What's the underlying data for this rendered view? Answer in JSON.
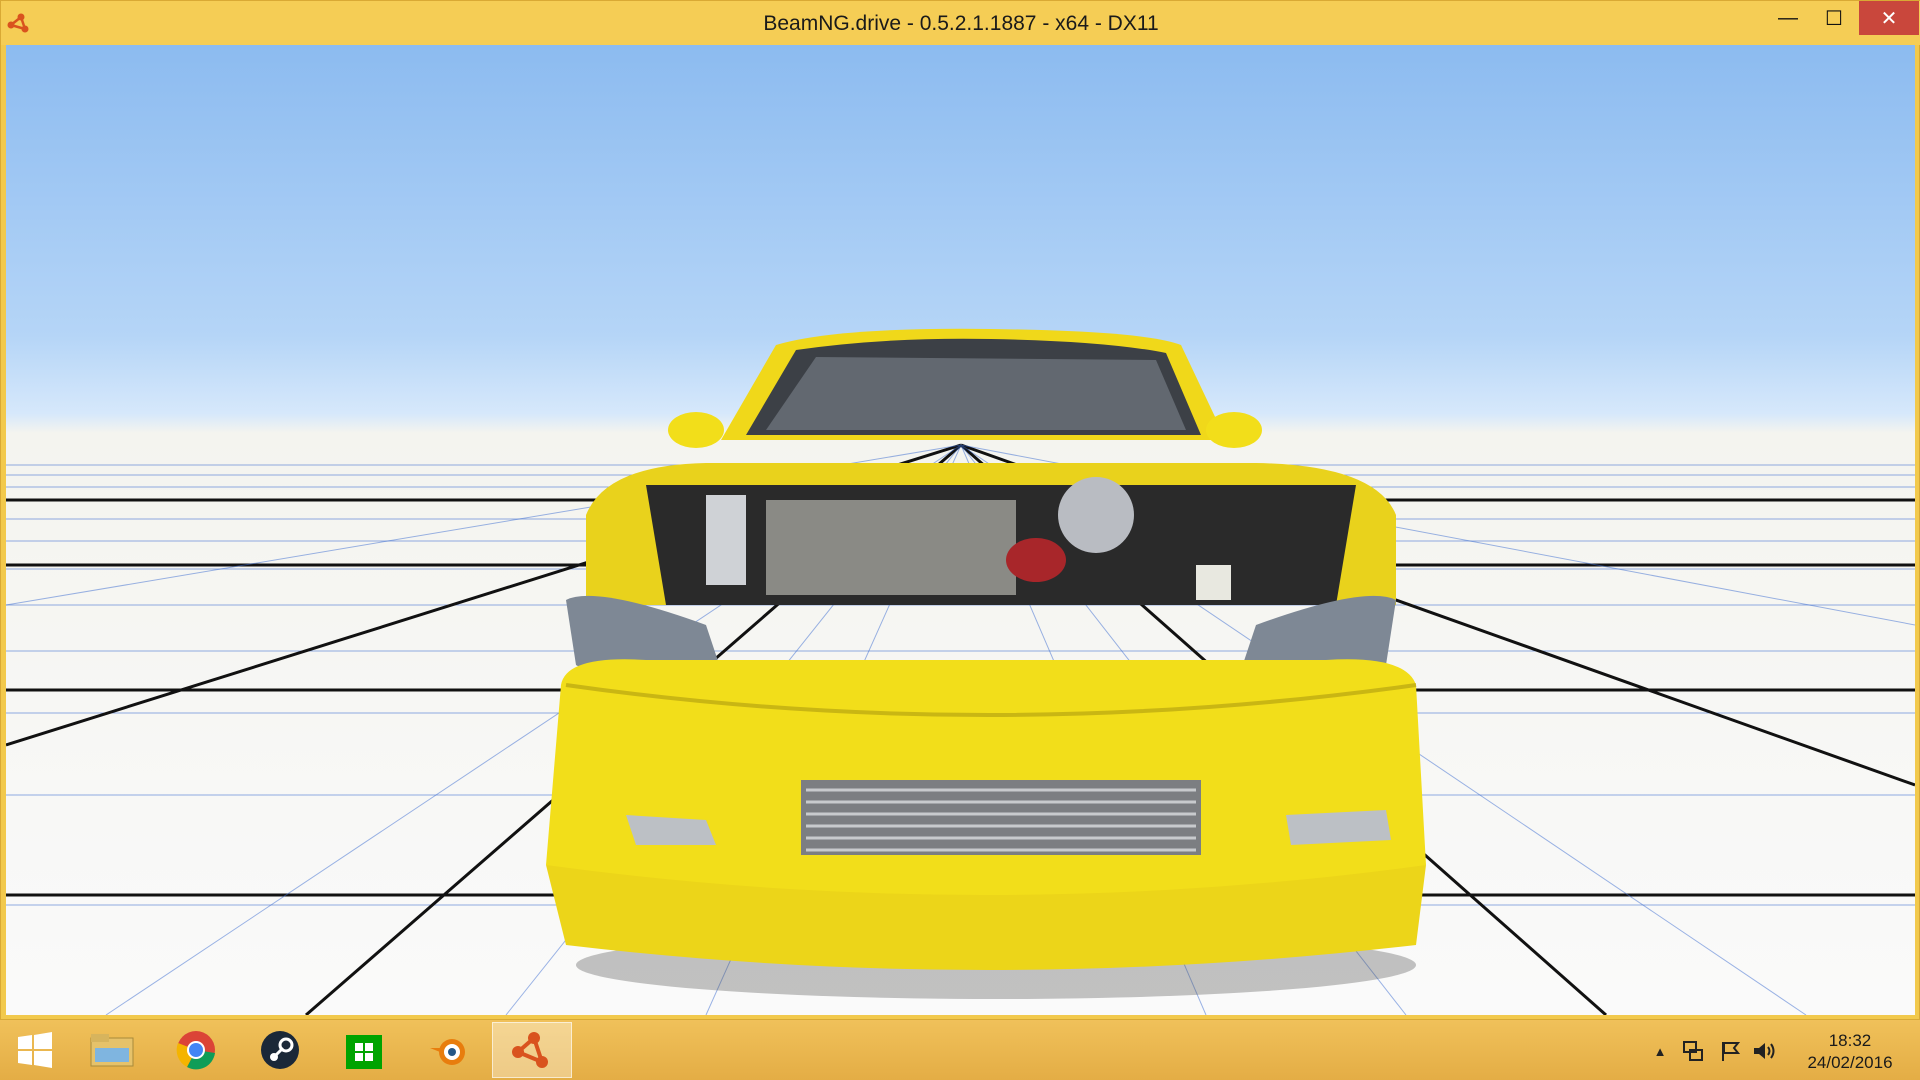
{
  "window": {
    "title": "BeamNG.drive - 0.5.2.1.1887 - x64 - DX11",
    "minimize_glyph": "—",
    "maximize_glyph": "☐",
    "close_glyph": "✕"
  },
  "taskbar": {
    "items": [
      {
        "name": "start-button",
        "icon": "windows-logo-icon"
      },
      {
        "name": "file-explorer",
        "icon": "folder-icon"
      },
      {
        "name": "chrome",
        "icon": "chrome-icon"
      },
      {
        "name": "steam",
        "icon": "steam-icon"
      },
      {
        "name": "store",
        "icon": "store-icon"
      },
      {
        "name": "blender",
        "icon": "blender-icon"
      },
      {
        "name": "beamng",
        "icon": "beamng-icon"
      }
    ],
    "clock": {
      "time": "18:32",
      "date": "24/02/2016"
    }
  },
  "colors": {
    "accent": "#f5cd55",
    "close_red": "#c9473c",
    "car_yellow": "#f2de1a"
  }
}
